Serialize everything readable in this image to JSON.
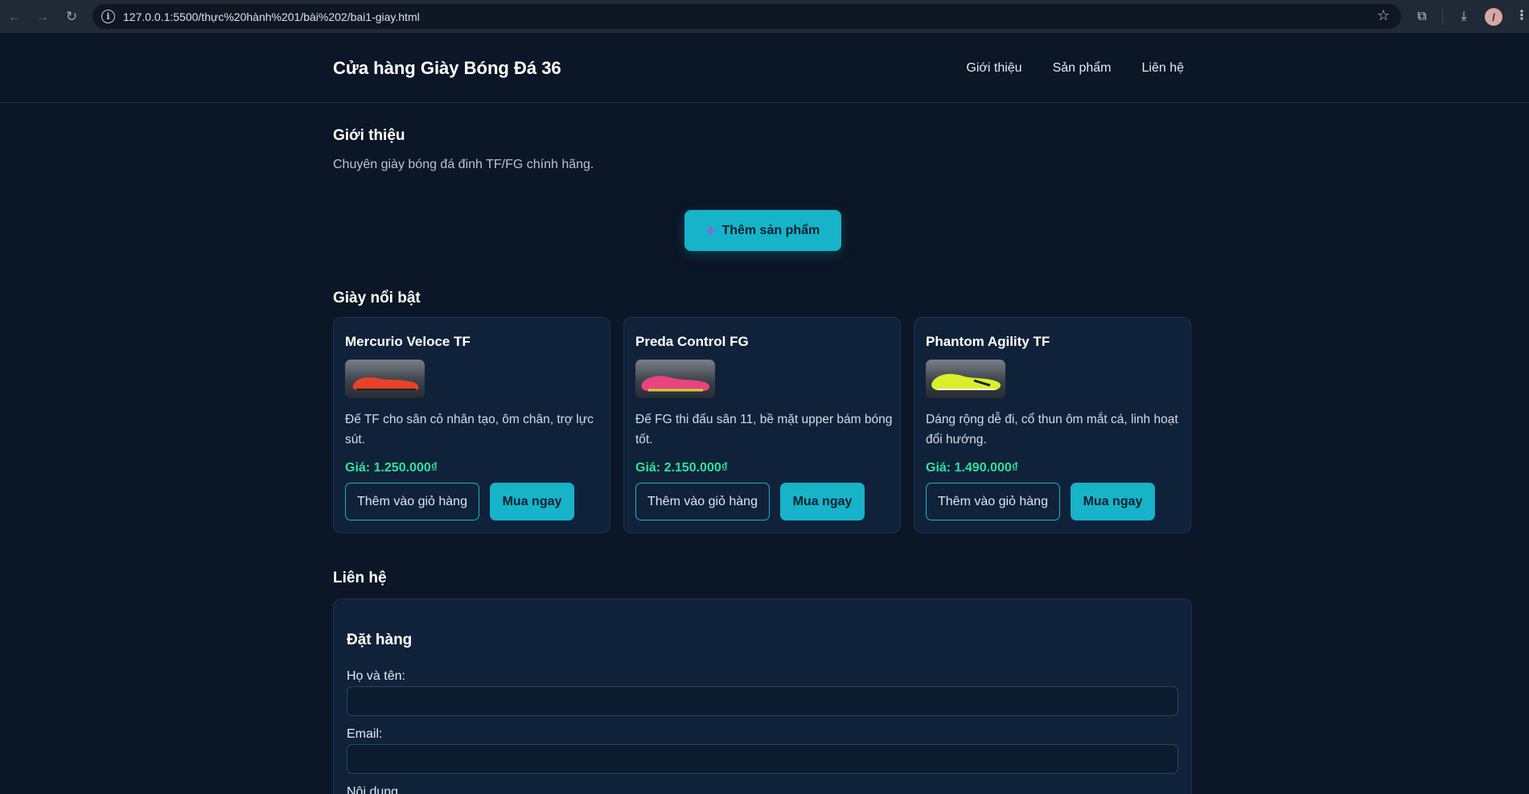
{
  "browser": {
    "url": "127.0.0.1:5500/thực%20hành%201/bài%202/bai1-giay.html",
    "icons": [
      "back-arrow-icon",
      "forward-arrow-icon",
      "reload-icon",
      "info-icon",
      "star-icon",
      "extensions-icon",
      "download-icon",
      "avatar",
      "menu-dots-icon"
    ]
  },
  "header": {
    "brand": "Cửa hàng Giày Bóng Đá 36",
    "nav": [
      "Giới thiệu",
      "Sản phẩm",
      "Liên hệ"
    ]
  },
  "intro": {
    "title": "Giới thiệu",
    "text": "Chuyên giày bóng đá đinh TF/FG chính hãng."
  },
  "add_product_button": {
    "icon": "plus-icon",
    "label": "Thêm sản phẩm"
  },
  "featured": {
    "title": "Giày nổi bật",
    "products": [
      {
        "name": "Mercurio Veloce TF",
        "description": "Đế TF cho sân cỏ nhân tạo, ôm chân, trợ lực sút.",
        "price": "Giá: 1.250.000₫",
        "shoe_color": "#e8432a",
        "cart_label": "Thêm vào giỏ hàng",
        "buy_label": "Mua ngay"
      },
      {
        "name": "Preda Control FG",
        "description": "Đế FG thi đấu sân 11, bề mặt upper bám bóng tốt.",
        "price": "Giá: 2.150.000₫",
        "shoe_color": "#e8457e",
        "cart_label": "Thêm vào giỏ hàng",
        "buy_label": "Mua ngay"
      },
      {
        "name": "Phantom Agility TF",
        "description": "Dáng rộng dễ đi, cổ thun ôm mắt cá, linh hoạt đổi hướng.",
        "price": "Giá: 1.490.000₫",
        "shoe_color": "#d8ef2a",
        "cart_label": "Thêm vào giỏ hàng",
        "buy_label": "Mua ngay"
      }
    ]
  },
  "contact": {
    "title": "Liên hệ",
    "form_title": "Đặt hàng",
    "name_label": "Họ và tên:",
    "name_value": "",
    "email_label": "Email:",
    "email_value": "",
    "content_label": "Nội dung"
  },
  "colors": {
    "accent": "#17b3c9",
    "price": "#2ee0a0",
    "background": "#0b1626",
    "card": "#10223a"
  }
}
